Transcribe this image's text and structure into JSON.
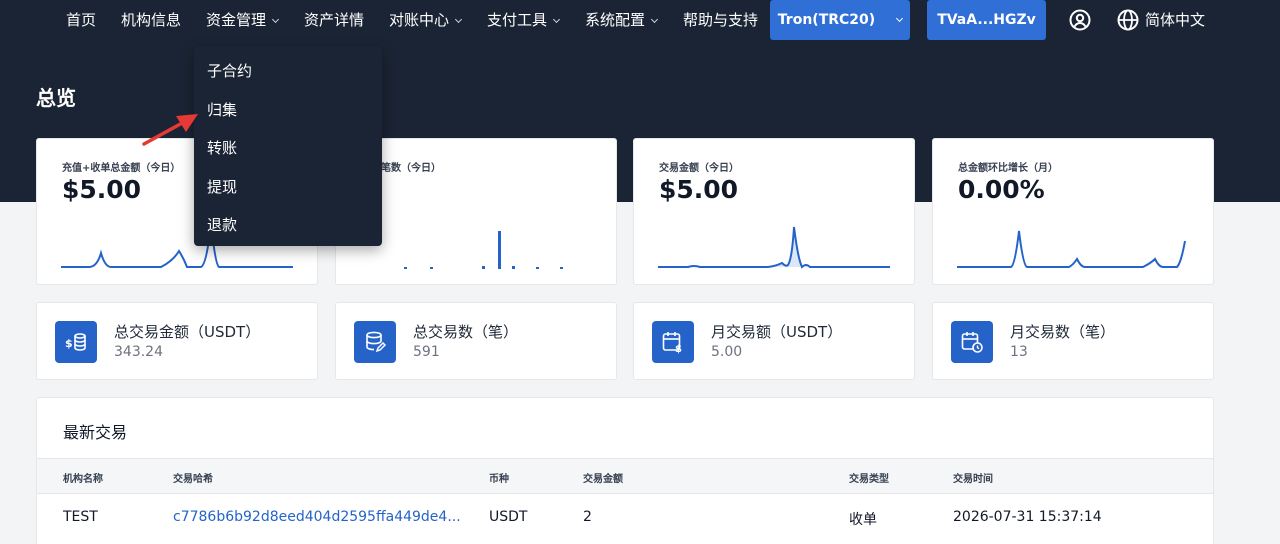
{
  "nav": {
    "items": [
      {
        "label": "首页",
        "has_caret": false
      },
      {
        "label": "机构信息",
        "has_caret": false
      },
      {
        "label": "资金管理",
        "has_caret": true
      },
      {
        "label": "资产详情",
        "has_caret": false
      },
      {
        "label": "对账中心",
        "has_caret": true
      },
      {
        "label": "支付工具",
        "has_caret": true
      },
      {
        "label": "系统配置",
        "has_caret": true
      },
      {
        "label": "帮助与支持",
        "has_caret": false
      }
    ],
    "network_button": "Tron(TRC20)",
    "wallet_button": "TVaA...HGZv",
    "account_icon": "user-circle-icon",
    "language_icon": "globe-icon",
    "language": "简体中文",
    "colors": {
      "nav_bg": "#1b2434",
      "accent": "#2f6fd6"
    }
  },
  "dropdown": {
    "items": [
      "子合约",
      "归集",
      "转账",
      "提现",
      "退款"
    ],
    "highlighted": "归集"
  },
  "page": {
    "title": "总览"
  },
  "kpis": [
    {
      "label": "充值+收单总金额（今日）",
      "value": "$5.00"
    },
    {
      "label": "交易笔数（今日）",
      "value": ""
    },
    {
      "label": "交易金额（今日）",
      "value": "$5.00"
    },
    {
      "label": "总金额环比增长（月）",
      "value": "0.00%"
    }
  ],
  "stats": [
    {
      "label": "总交易金额（USDT）",
      "value": "343.24",
      "icon": "coin-stack-dollar-icon"
    },
    {
      "label": "总交易数（笔）",
      "value": "591",
      "icon": "database-edit-icon"
    },
    {
      "label": "月交易额（USDT）",
      "value": "5.00",
      "icon": "calendar-dollar-icon"
    },
    {
      "label": "月交易数（笔）",
      "value": "13",
      "icon": "calendar-clock-icon"
    }
  ],
  "transactions": {
    "title": "最新交易",
    "columns": [
      "机构名称",
      "交易哈希",
      "币种",
      "交易金额",
      "交易类型",
      "交易时间"
    ],
    "rows": [
      {
        "org": "TEST",
        "hash": "c7786b6b92d8eed404d2595ffa449de4...",
        "currency": "USDT",
        "amount": "2",
        "type": "收单",
        "time": "2026-07-31 15:37:14"
      }
    ]
  }
}
